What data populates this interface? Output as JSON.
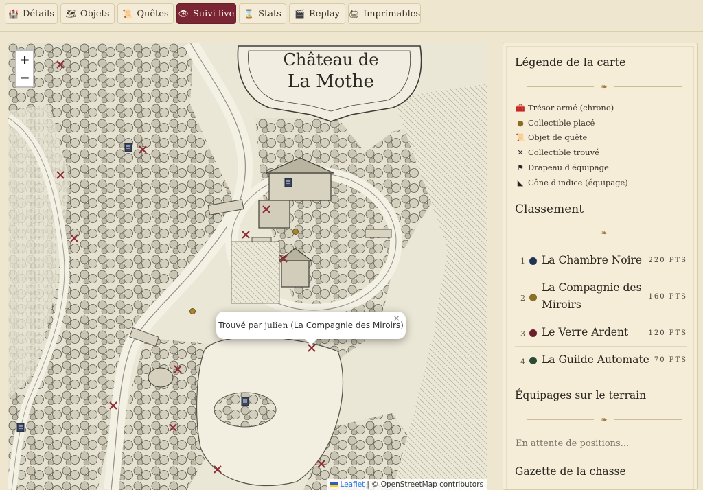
{
  "tabs": [
    {
      "label": "Détails",
      "icon": "castle-icon",
      "glyph": "🏰",
      "active": false
    },
    {
      "label": "Objets",
      "icon": "map-icon",
      "glyph": "🗺",
      "active": false
    },
    {
      "label": "Quêtes",
      "icon": "scroll-icon",
      "glyph": "📜",
      "active": false
    },
    {
      "label": "Suivi live",
      "icon": "eye-icon",
      "glyph": "👁",
      "active": true
    },
    {
      "label": "Stats",
      "icon": "hourglass-icon",
      "glyph": "⌛",
      "active": false
    },
    {
      "label": "Replay",
      "icon": "film-icon",
      "glyph": "🎬",
      "active": false
    },
    {
      "label": "Imprimables",
      "icon": "printer-icon",
      "glyph": "🖨",
      "active": false
    }
  ],
  "map": {
    "title_line1": "Château de",
    "title_line2": "La Mothe",
    "zoom_in": "+",
    "zoom_out": "−",
    "popup": {
      "prefix": "Trouvé par ",
      "finder": "julien",
      "team": " (La Compagnie des Miroirs)",
      "close": "×"
    },
    "attribution": {
      "leaflet": "Leaflet",
      "separator": "|",
      "osm": "© OpenStreetMap contributors"
    }
  },
  "legend": {
    "title": "Légende de la carte",
    "ornament": "❧",
    "items": [
      {
        "icon": "chest-icon",
        "glyph": "🧰",
        "label": "Trésor armé (chrono)"
      },
      {
        "icon": "collectible-dot-icon",
        "glyph": "●",
        "label": "Collectible placé"
      },
      {
        "icon": "scroll-icon",
        "glyph": "📜",
        "label": "Objet de quête"
      },
      {
        "icon": "cross-icon",
        "glyph": "✕",
        "label": "Collectible trouvé"
      },
      {
        "icon": "flag-icon",
        "glyph": "⚑",
        "label": "Drapeau d'équipage"
      },
      {
        "icon": "cone-icon",
        "glyph": "◣",
        "label": "Cône d'indice (équipage)"
      }
    ]
  },
  "ranking": {
    "title": "Classement",
    "ornament": "❧",
    "rows": [
      {
        "rank": "1",
        "team_line1": "La Chambre Noire",
        "team_line2": "",
        "points": "220 PTS",
        "color": "#1f3357"
      },
      {
        "rank": "2",
        "team_line1": "La Compagnie des",
        "team_line2": "Miroirs",
        "points": "160 PTS",
        "color": "#8a7128"
      },
      {
        "rank": "3",
        "team_line1": "Le Verre Ardent",
        "team_line2": "",
        "points": "120 PTS",
        "color": "#6b1f2b"
      },
      {
        "rank": "4",
        "team_line1": "La Guilde Automate",
        "team_line2": "",
        "points": "70 PTS",
        "color": "#2d4a34"
      }
    ]
  },
  "crews": {
    "title": "Équipages sur le terrain",
    "ornament": "❧",
    "status": "En attente de positions..."
  },
  "gazette": {
    "title": "Gazette de la chasse"
  }
}
